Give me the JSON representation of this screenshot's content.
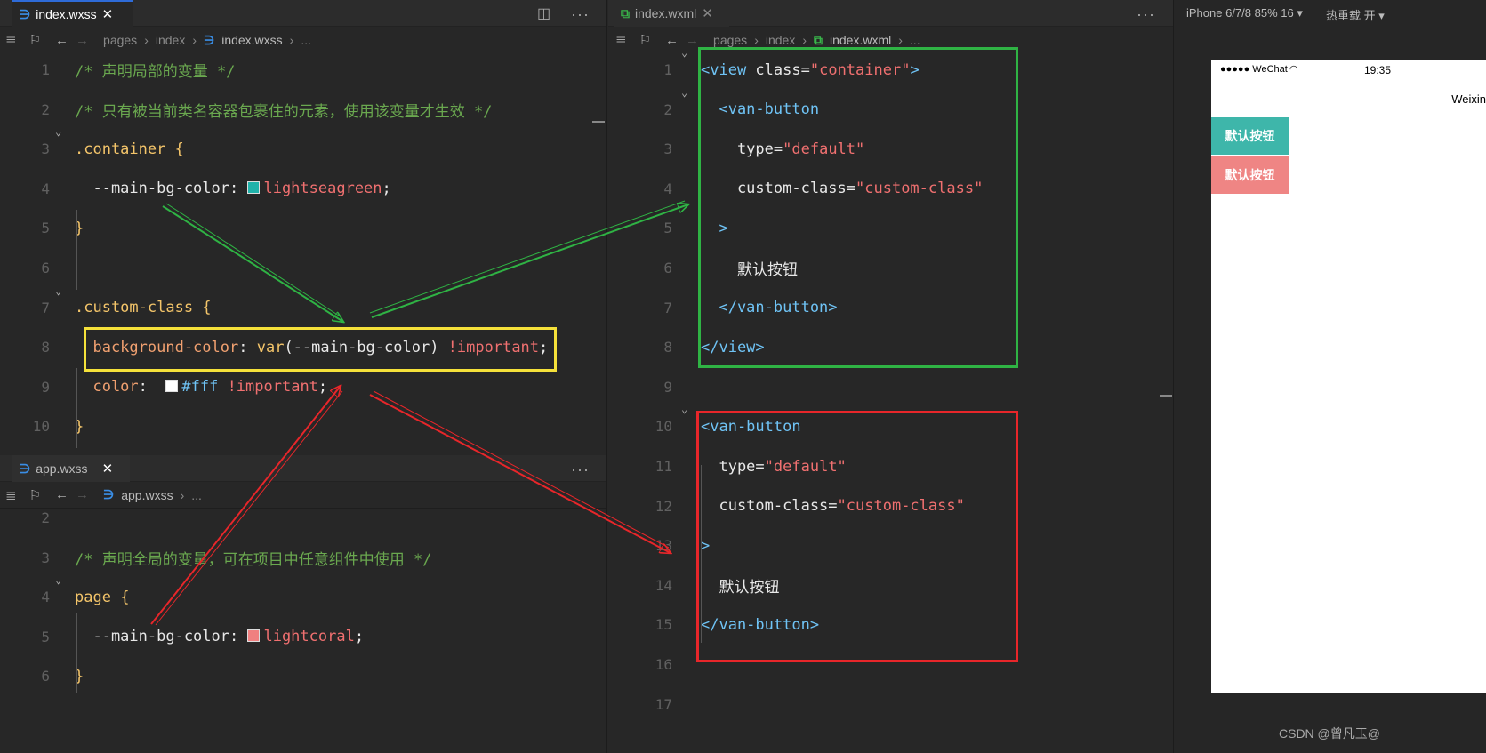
{
  "left_top": {
    "tab": "index.wxss",
    "breadcrumb": [
      "pages",
      "index",
      "index.wxss",
      "..."
    ],
    "lines": [
      {
        "n": "1",
        "html": [
          {
            "c": "cm",
            "t": "/* 声明局部的变量 */"
          }
        ]
      },
      {
        "n": "2",
        "html": [
          {
            "c": "cm",
            "t": "/* 只有被当前类名容器包裹住的元素，使用该变量才生效 */"
          }
        ]
      },
      {
        "n": "3",
        "html": [
          {
            "c": "sel",
            "t": ".container "
          },
          {
            "c": "br",
            "t": "{"
          }
        ]
      },
      {
        "n": "4",
        "html": [
          {
            "c": "pr",
            "t": "  --main-bg-color: "
          },
          {
            "c": "sw",
            "t": "#20b2aa"
          },
          {
            "c": "vl",
            "t": "lightseagreen"
          },
          {
            "c": "pr",
            "t": ";"
          }
        ]
      },
      {
        "n": "5",
        "html": [
          {
            "c": "br",
            "t": "}"
          }
        ]
      },
      {
        "n": "6",
        "html": []
      },
      {
        "n": "7",
        "html": [
          {
            "c": "sel",
            "t": ".custom-class "
          },
          {
            "c": "br",
            "t": "{"
          }
        ]
      },
      {
        "n": "8",
        "html": [
          {
            "c": "pr2",
            "t": "  background-color"
          },
          {
            "c": "pr",
            "t": ": "
          },
          {
            "c": "fn",
            "t": "var"
          },
          {
            "c": "pr",
            "t": "(--main-bg-color) "
          },
          {
            "c": "kw",
            "t": "!important"
          },
          {
            "c": "pr",
            "t": ";"
          }
        ]
      },
      {
        "n": "9",
        "html": [
          {
            "c": "pr2",
            "t": "  color"
          },
          {
            "c": "pr",
            "t": ":  "
          },
          {
            "c": "sw",
            "t": "#ffffff"
          },
          {
            "c": "tag",
            "t": "#fff"
          },
          {
            "c": "kw",
            "t": " !important"
          },
          {
            "c": "pr",
            "t": ";"
          }
        ]
      },
      {
        "n": "10",
        "html": [
          {
            "c": "br",
            "t": "}"
          }
        ]
      }
    ]
  },
  "left_bottom": {
    "tab": "app.wxss",
    "breadcrumb": [
      "app.wxss",
      "..."
    ],
    "lines": [
      {
        "n": "2",
        "html": []
      },
      {
        "n": "3",
        "html": [
          {
            "c": "cm",
            "t": "/* 声明全局的变量，可在项目中任意组件中使用 */"
          }
        ]
      },
      {
        "n": "4",
        "html": [
          {
            "c": "sel",
            "t": "page "
          },
          {
            "c": "br",
            "t": "{"
          }
        ]
      },
      {
        "n": "5",
        "html": [
          {
            "c": "pr",
            "t": "  --main-bg-color: "
          },
          {
            "c": "sw",
            "t": "#f08080"
          },
          {
            "c": "vl",
            "t": "lightcoral"
          },
          {
            "c": "pr",
            "t": ";"
          }
        ]
      },
      {
        "n": "6",
        "html": [
          {
            "c": "br",
            "t": "}"
          }
        ]
      }
    ]
  },
  "middle": {
    "tab": "index.wxml",
    "breadcrumb": [
      "pages",
      "index",
      "index.wxml",
      "..."
    ],
    "lines": [
      {
        "n": "1",
        "html": [
          {
            "c": "tag",
            "t": "<view "
          },
          {
            "c": "attr",
            "t": "class"
          },
          {
            "c": "plain",
            "t": "="
          },
          {
            "c": "str",
            "t": "\"container\""
          },
          {
            "c": "tag",
            "t": ">"
          }
        ]
      },
      {
        "n": "2",
        "html": [
          {
            "c": "tag",
            "t": "  <van-button"
          }
        ]
      },
      {
        "n": "3",
        "html": [
          {
            "c": "attr",
            "t": "    type"
          },
          {
            "c": "plain",
            "t": "="
          },
          {
            "c": "str",
            "t": "\"default\""
          }
        ]
      },
      {
        "n": "4",
        "html": [
          {
            "c": "attr",
            "t": "    custom-class"
          },
          {
            "c": "plain",
            "t": "="
          },
          {
            "c": "str",
            "t": "\"custom-class\""
          }
        ]
      },
      {
        "n": "5",
        "html": [
          {
            "c": "tag",
            "t": "  >"
          }
        ]
      },
      {
        "n": "6",
        "html": [
          {
            "c": "plain",
            "t": "    默认按钮"
          }
        ]
      },
      {
        "n": "7",
        "html": [
          {
            "c": "tag",
            "t": "  </van-button>"
          }
        ]
      },
      {
        "n": "8",
        "html": [
          {
            "c": "tag",
            "t": "</view>"
          }
        ]
      },
      {
        "n": "9",
        "html": []
      },
      {
        "n": "10",
        "html": [
          {
            "c": "tag",
            "t": "<van-button"
          }
        ]
      },
      {
        "n": "11",
        "html": [
          {
            "c": "attr",
            "t": "  type"
          },
          {
            "c": "plain",
            "t": "="
          },
          {
            "c": "str",
            "t": "\"default\""
          }
        ]
      },
      {
        "n": "12",
        "html": [
          {
            "c": "attr",
            "t": "  custom-class"
          },
          {
            "c": "plain",
            "t": "="
          },
          {
            "c": "str",
            "t": "\"custom-class\""
          }
        ]
      },
      {
        "n": "13",
        "html": [
          {
            "c": "tag",
            "t": ">"
          }
        ]
      },
      {
        "n": "14",
        "html": [
          {
            "c": "plain",
            "t": "  默认按钮"
          }
        ]
      },
      {
        "n": "15",
        "html": [
          {
            "c": "tag",
            "t": "</van-button>"
          }
        ]
      },
      {
        "n": "16",
        "html": []
      },
      {
        "n": "17",
        "html": []
      }
    ]
  },
  "simulator": {
    "device": "iPhone 6/7/8 85% 16 ▾",
    "hotreload": "热重载 开 ▾",
    "carrier": "●●●●● WeChat",
    "time": "19:35",
    "nav_title": "Weixin",
    "button1": "默认按钮",
    "button2": "默认按钮",
    "button1_color": "#3eb6aa",
    "button2_color": "#ef8584"
  },
  "watermark": "CSDN @曾凡玉@",
  "colors": {
    "green_box": "#2fb344",
    "red_box": "#e8262a",
    "yellow_box": "#f5e13a"
  }
}
